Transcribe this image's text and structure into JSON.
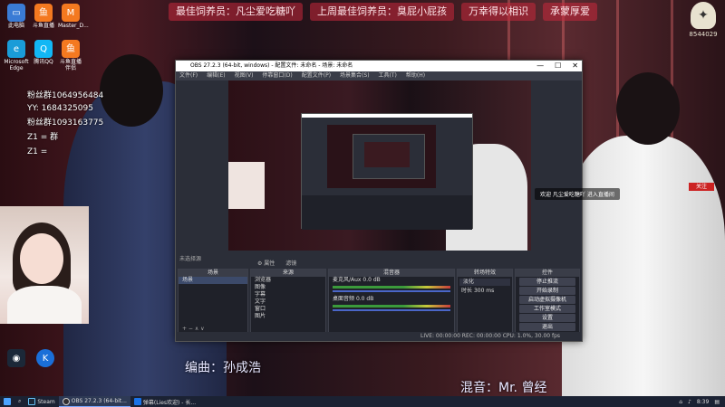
{
  "banner": {
    "items": [
      "最佳饲养员：凡尘爱吃糖吖",
      "上周最佳饲养员：臭屁小屁孩",
      "万幸得以相识",
      "承蒙厚爱"
    ]
  },
  "logo": {
    "id": "8544029"
  },
  "desktop_icons": [
    {
      "label": "此电脑",
      "color": "#3a7bd5",
      "glyph": "▭"
    },
    {
      "label": "斗鱼直播",
      "color": "#f47920",
      "glyph": "鱼"
    },
    {
      "label": "Master_D...",
      "color": "#f47920",
      "glyph": "M"
    },
    {
      "label": "Microsoft Edge",
      "color": "#1a9cd8",
      "glyph": "e"
    },
    {
      "label": "腾讯QQ",
      "color": "#12b7f5",
      "glyph": "Q"
    },
    {
      "label": "斗鱼直播伴侣",
      "color": "#f47920",
      "glyph": "鱼"
    }
  ],
  "overlay_lines": [
    "粉丝群1064956484",
    "YY: 1684325095",
    "粉丝群1093163775",
    "Z1 = 群",
    "Z1 ="
  ],
  "obs": {
    "title": "OBS 27.2.3 (64-bit, windows) - 配置文件: 未命名 - 场景: 未命名",
    "window_controls": [
      "—",
      "☐",
      "✕"
    ],
    "menu": [
      "文件(F)",
      "编辑(E)",
      "视图(V)",
      "停靠窗口(D)",
      "配置文件(P)",
      "场景集合(S)",
      "工具(T)",
      "帮助(H)"
    ],
    "status_text": "未选择源",
    "mini_toolbar": [
      "⚙ 属性",
      "滤镜"
    ],
    "scenes": {
      "title": "场景",
      "items": [
        "场景"
      ]
    },
    "sources": {
      "title": "来源",
      "items": [
        "浏览器",
        "图像",
        "字幕",
        "文字",
        "窗口",
        "图片"
      ]
    },
    "mixer": {
      "title": "混音器",
      "channels": [
        {
          "name": "麦克风/Aux",
          "db": "0.0 dB"
        },
        {
          "name": "桌面音频",
          "db": "0.0 dB"
        }
      ]
    },
    "transitions": {
      "title": "转场特效",
      "type": "淡化",
      "duration_label": "时长",
      "duration": "300 ms"
    },
    "controls": {
      "title": "控件",
      "buttons": [
        "停止推流",
        "开始录制",
        "启动虚拟摄像机",
        "工作室模式",
        "设置",
        "退出"
      ]
    },
    "bottom": "LIVE: 00:00:00   REC: 00:00:00   CPU: 1.0%, 30.00 fps"
  },
  "chat_message": "欢迎 凡尘爱吃糖吖 进入直播间",
  "follow_tag": "关注",
  "credits": {
    "editor": "编曲：孙成浩",
    "lyrics": "混音：Mr. 曾经"
  },
  "taskbar": {
    "items": [
      {
        "label": "Steam",
        "color": "#1b2838"
      },
      {
        "label": "OBS 27.2.3 (64-bit...",
        "color": "#302e31"
      },
      {
        "label": "弹幕(Lies欢迎) - 长...",
        "color": "#1a73e8"
      }
    ],
    "time": "8:39"
  }
}
